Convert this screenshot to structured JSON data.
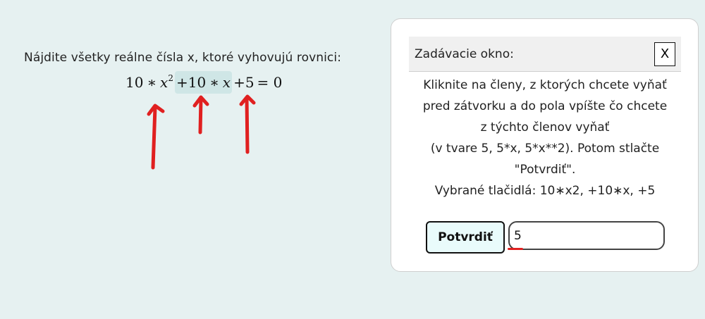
{
  "task": {
    "prompt": "Nájdite všetky reálne čísla x, ktoré vyhovujú rovnici:"
  },
  "equation": {
    "term1": {
      "coef": "10",
      "op": "∗",
      "var": "x",
      "exp": "2"
    },
    "term2": {
      "coef": "+10",
      "op": "∗",
      "var": "x"
    },
    "term3": {
      "coef": "+5"
    },
    "rest": "= 0",
    "highlighted_term": "term2"
  },
  "annotations": {
    "arrow_color": "#e02020",
    "arrow_count": 3
  },
  "panel": {
    "title": "Zadávacie okno:",
    "close_label": "X",
    "instruction_lines": [
      "Kliknite na členy, z ktorých chcete vyňať",
      "pred zátvorku a do pola vpíšte čo chcete",
      "z týchto členov vyňať",
      "(v tvare 5, 5*x, 5*x**2). Potom stlačte",
      "\"Potvrdiť\".",
      "Vybrané tlačidlá: 10∗x2, +10∗x, +5"
    ],
    "confirm_label": "Potvrdiť",
    "input_value": "5"
  }
}
